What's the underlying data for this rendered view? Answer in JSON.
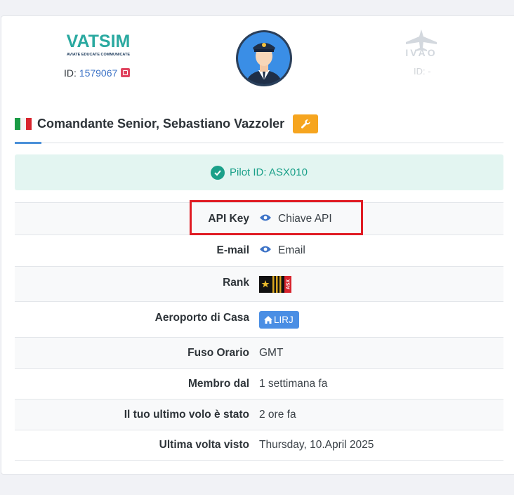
{
  "vatsim": {
    "logo_text": "VATSIM",
    "tagline": "AVIATE EDUCATE COMMUNICATE",
    "id_prefix": "ID: ",
    "id_value": "1579067"
  },
  "ivao": {
    "logo_text": "IVAO",
    "id_text": "ID: -"
  },
  "profile": {
    "name": "Comandante Senior, Sebastiano Vazzoler"
  },
  "alert": {
    "text": "Pilot ID: ASX010"
  },
  "table": {
    "api_key_label": "API Key",
    "api_key_value": "Chiave API",
    "email_label": "E-mail",
    "email_value": "Email",
    "rank_label": "Rank",
    "rank_badge_text": "ASX",
    "home_airport_label": "Aeroporto di Casa",
    "home_airport_value": "LIRJ",
    "timezone_label": "Fuso Orario",
    "timezone_value": "GMT",
    "member_since_label": "Membro dal",
    "member_since_value": "1 settimana fa",
    "last_flight_label": "Il tuo ultimo volo è stato",
    "last_flight_value": "2 ore fa",
    "last_seen_label": "Ultima volta visto",
    "last_seen_value": "Thursday, 10.April 2025"
  },
  "colors": {
    "accent": "#4a90d9",
    "success": "#1aa089",
    "warning": "#f6a51f",
    "danger": "#e01c24"
  }
}
